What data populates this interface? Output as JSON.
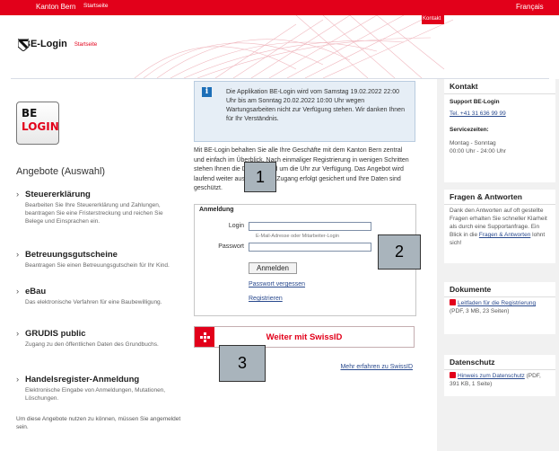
{
  "topbar": {
    "canton": "Kanton Bern",
    "home": "Startseite",
    "language": "Français",
    "contact": "Kontakt"
  },
  "header": {
    "app_title": "BE-Login",
    "subtitle": "Startseite"
  },
  "logo": {
    "line1": "BE",
    "line2": "LOGIN"
  },
  "offers": {
    "title": "Angebote (Auswahl)",
    "items": [
      {
        "title": "Steuererklärung",
        "desc": "Bearbeiten Sie Ihre Steuererklärung und Zahlungen, beantragen Sie eine Fristerstreckung und reichen Sie Belege und Einsprachen ein."
      },
      {
        "title": "Betreuungsgutscheine",
        "desc": "Beantragen Sie einen Betreuungsgutschein für Ihr Kind."
      },
      {
        "title": "eBau",
        "desc": "Das elektronische Verfahren für eine Baubewilligung."
      },
      {
        "title": "GRUDIS public",
        "desc": "Zugang zu den öffentlichen Daten des Grundbuchs."
      },
      {
        "title": "Handelsregister-Anmeldung",
        "desc": "Elektronische Eingabe von Anmeldungen, Mutationen, Löschungen."
      }
    ],
    "footnote": "Um diese Angebote nutzen zu können, müssen Sie angemeldet sein."
  },
  "notice": {
    "icon": "info-icon",
    "text": "Die Applikation BE-Login wird vom Samstag 19.02.2022 22:00 Uhr bis am Sonntag 20.02.2022 10:00 Uhr wegen Wartungsarbeiten nicht zur Verfügung stehen. Wir danken Ihnen für Ihr Verständnis."
  },
  "intro": "Mit BE-Login behalten Sie alle Ihre Geschäfte mit dem Kanton Bern zentral und einfach im Überblick. Nach einmaliger Registrierung in wenigen Schritten stehen Ihnen die Dienste rund um die Uhr zur Verfügung. Das Angebot wird laufend weiter ausgebaut. Ihr Zugang erfolgt gesichert und Ihre Daten sind geschützt.",
  "login": {
    "heading": "Anmeldung",
    "login_label": "Login",
    "login_value": "",
    "login_hint": "E-Mail-Adresse oder Mitarbeiter-Login",
    "password_label": "Passwort",
    "password_value": "",
    "submit": "Anmelden",
    "forgot": "Passwort vergessen",
    "register": "Registrieren"
  },
  "swissid": {
    "button": "Weiter mit SwissID",
    "more": "Mehr erfahren zu SwissID"
  },
  "callouts": [
    "1",
    "2",
    "3"
  ],
  "contact": {
    "title": "Kontakt",
    "support_title": "Support BE-Login",
    "phone": "Tel. +41 31 636 99 99",
    "hours_title": "Servicezeiten:",
    "hours_days": "Montag - Sonntag",
    "hours_time": "00:00 Uhr - 24:00 Uhr"
  },
  "faq": {
    "title": "Fragen & Antworten",
    "text_before": "Dank den Antworten auf oft gestellte Fragen erhalten Sie schneller Klarheit als durch eine Supportanfrage. Ein Blick in die ",
    "link": "Fragen & Antworten",
    "text_after": " lohnt sich!"
  },
  "documents": {
    "title": "Dokumente",
    "link": "Leitfaden für die Registrierung",
    "meta": " (PDF, 3 MB, 23 Seiten)"
  },
  "privacy": {
    "title": "Datenschutz",
    "link": "Hinweis zum Datenschutz",
    "meta": " (PDF, 391 KB, 1 Seite)"
  },
  "colors": {
    "brand_red": "#e2001a",
    "link_blue": "#2a4a8e",
    "notice_bg": "#e6eef6",
    "callout_gray": "#a9b4bc"
  }
}
